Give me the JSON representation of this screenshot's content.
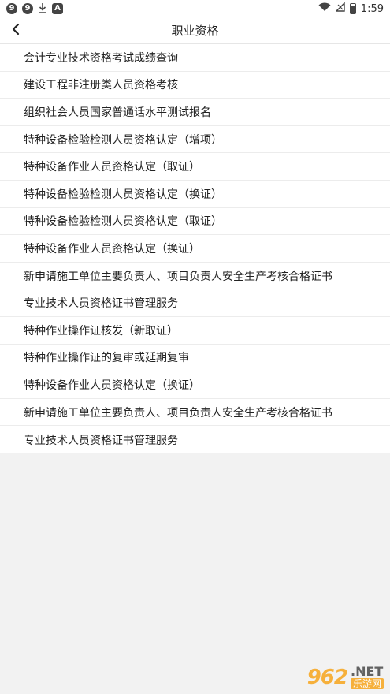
{
  "status_bar": {
    "left_badges": [
      "9",
      "9"
    ],
    "download_icon": "download-icon",
    "a_badge": "A",
    "time": "1:59"
  },
  "header": {
    "title": "职业资格"
  },
  "items": [
    "会计专业技术资格考试成绩查询",
    "建设工程非注册类人员资格考核",
    "组织社会人员国家普通话水平测试报名",
    "特种设备检验检测人员资格认定（增项）",
    "特种设备作业人员资格认定（取证）",
    "特种设备检验检测人员资格认定（换证）",
    "特种设备检验检测人员资格认定（取证）",
    "特种设备作业人员资格认定（换证）",
    "新申请施工单位主要负责人、项目负责人安全生产考核合格证书",
    "专业技术人员资格证书管理服务",
    "特种作业操作证核发（新取证）",
    "特种作业操作证的复审或延期复审",
    "特种设备作业人员资格认定（换证）",
    "新申请施工单位主要负责人、项目负责人安全生产考核合格证书",
    "专业技术人员资格证书管理服务"
  ],
  "watermark": {
    "logo": "962",
    "net": ".NET",
    "cn": "乐游网"
  }
}
